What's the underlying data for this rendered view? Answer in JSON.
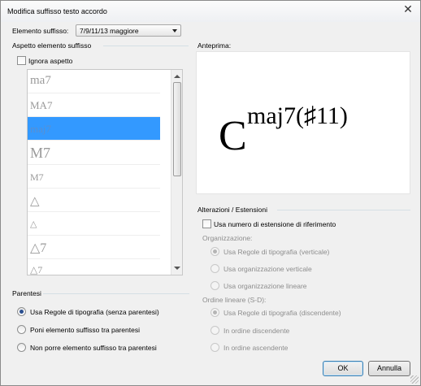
{
  "window": {
    "title": "Modifica suffisso testo accordo",
    "close_symbol": "✕"
  },
  "suffix_element": {
    "label": "Elemento suffisso:",
    "selected": "7/9/11/13 maggiore"
  },
  "appearance_group": {
    "title": "Aspetto elemento suffisso",
    "ignore_label": "Ignora aspetto",
    "items": [
      "ma7",
      "MA7",
      "maj7",
      "M7",
      "M7",
      "△",
      "△",
      "△7",
      "△7"
    ],
    "selected_index": 2
  },
  "preview": {
    "label": "Anteprima:",
    "chord_root": "C",
    "chord_suffix": "maj7(♯11)"
  },
  "parentheses_group": {
    "title": "Parentesi",
    "options": [
      {
        "label": "Usa Regole di tipografia (senza parentesi)",
        "checked": true
      },
      {
        "label": "Poni elemento suffisso tra parentesi",
        "checked": false
      },
      {
        "label": "Non porre elemento suffisso tra parentesi",
        "checked": false
      }
    ]
  },
  "extensions_group": {
    "title": "Alterazioni / Estensioni",
    "use_reference_label": "Usa numero di estensione di riferimento",
    "organization_label": "Organizzazione:",
    "organization_options": [
      {
        "label": "Usa Regole di tipografia (verticale)",
        "checked": true
      },
      {
        "label": "Usa organizzazione verticale",
        "checked": false
      },
      {
        "label": "Usa organizzazione lineare",
        "checked": false
      }
    ],
    "linear_order_label": "Ordine lineare (S-D):",
    "linear_order_options": [
      {
        "label": "Usa Regole di tipografia (discendente)",
        "checked": true
      },
      {
        "label": "In ordine discendente",
        "checked": false
      },
      {
        "label": "In ordine ascendente",
        "checked": false
      }
    ]
  },
  "buttons": {
    "ok": "OK",
    "cancel": "Annulla"
  }
}
